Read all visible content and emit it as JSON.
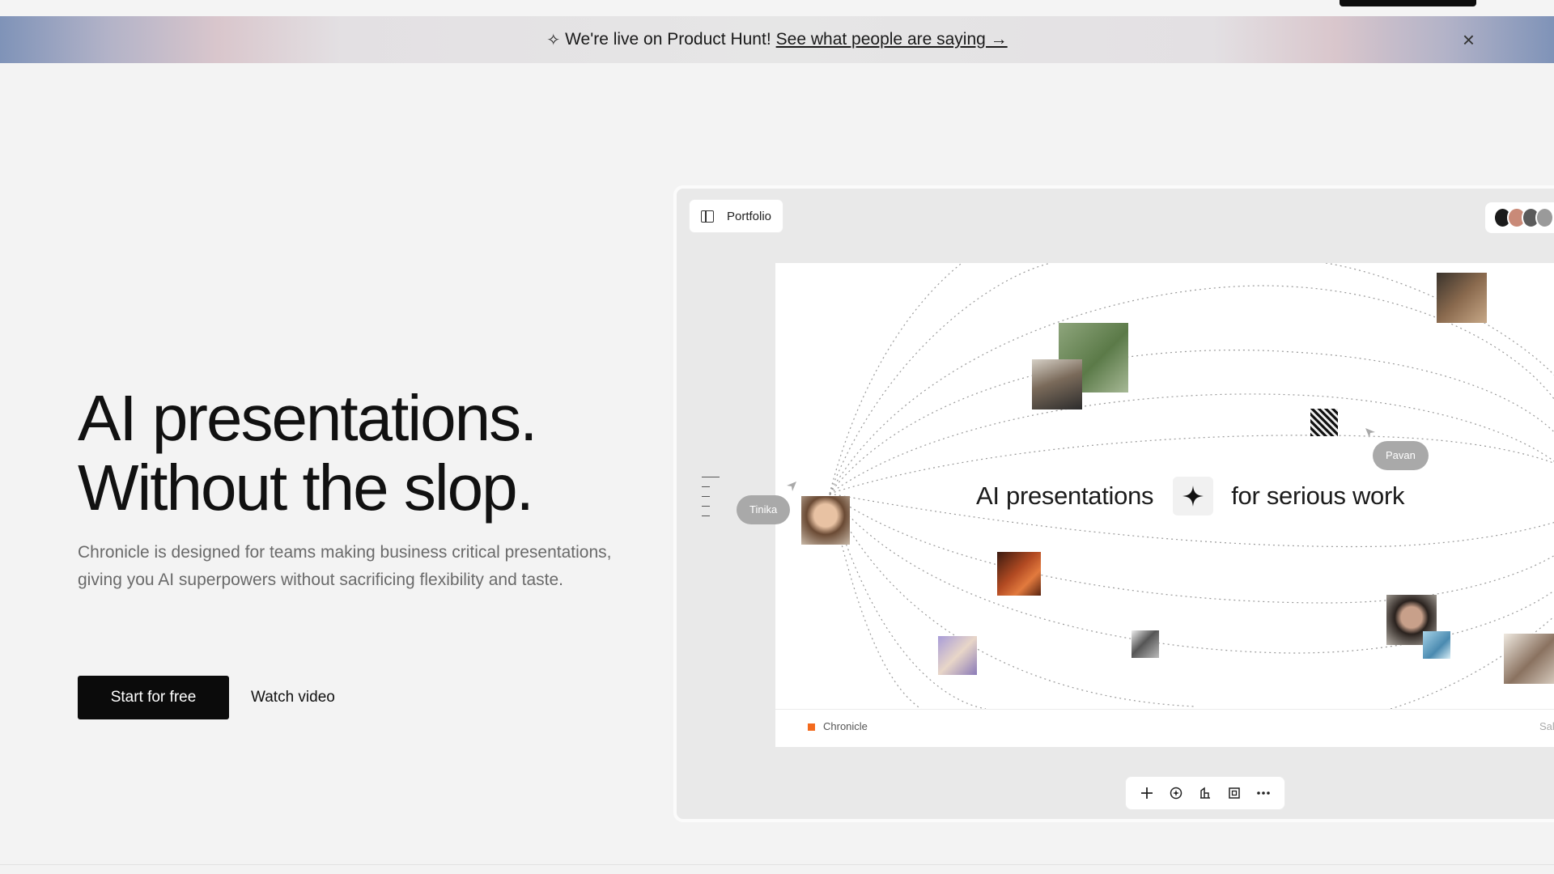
{
  "banner": {
    "sparkle": "✧",
    "text": "We're live on Product Hunt!",
    "link": "See what people are saying →",
    "close": "×"
  },
  "hero": {
    "title_line1": "AI presentations.",
    "title_line2": "Without the slop.",
    "description": "Chronicle is designed for teams making business critical presentations, giving you AI superpowers without sacrificing flexibility and taste.",
    "primary_cta": "Start for free",
    "secondary_cta": "Watch video"
  },
  "mockup": {
    "portfolio_label": "Portfolio",
    "slide": {
      "headline_left": "AI presentations",
      "headline_right": "for serious work",
      "footer_brand": "Chronicle",
      "footer_right": "Sale"
    },
    "collaborators": [
      {
        "name": "Tinika"
      },
      {
        "name": "Pavan"
      }
    ],
    "toolbar": [
      "add-icon",
      "ai-icon",
      "shapes-icon",
      "frame-icon",
      "more-icon"
    ]
  },
  "colors": {
    "accent_orange": "#f36a1d",
    "button_dark": "#0b0b0b",
    "page_bg": "#f3f3f3"
  }
}
